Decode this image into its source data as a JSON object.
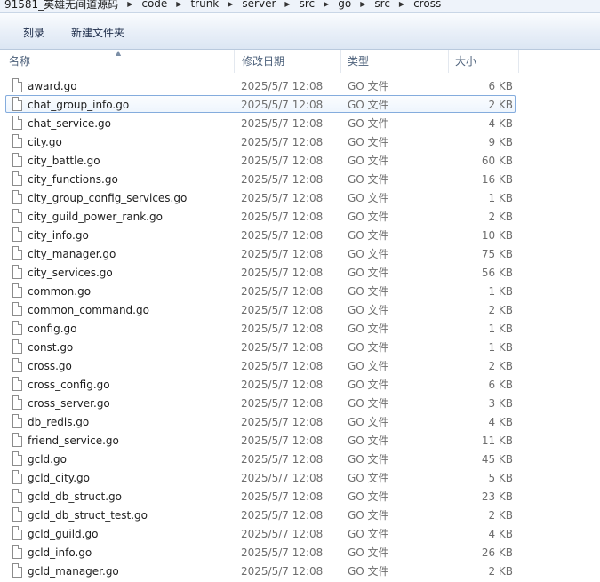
{
  "address": {
    "crumbs": [
      "91581_英雄无间道源码",
      "code",
      "trunk",
      "server",
      "src",
      "go",
      "src",
      "cross"
    ]
  },
  "toolbar": {
    "burn_label": "刻录",
    "new_folder_label": "新建文件夹"
  },
  "columns": {
    "name": "名称",
    "date": "修改日期",
    "type": "类型",
    "size": "大小"
  },
  "selected_index": 1,
  "files": [
    {
      "name": "award.go",
      "date": "2025/5/7 12:08",
      "type": "GO 文件",
      "size": "6 KB"
    },
    {
      "name": "chat_group_info.go",
      "date": "2025/5/7 12:08",
      "type": "GO 文件",
      "size": "2 KB"
    },
    {
      "name": "chat_service.go",
      "date": "2025/5/7 12:08",
      "type": "GO 文件",
      "size": "4 KB"
    },
    {
      "name": "city.go",
      "date": "2025/5/7 12:08",
      "type": "GO 文件",
      "size": "9 KB"
    },
    {
      "name": "city_battle.go",
      "date": "2025/5/7 12:08",
      "type": "GO 文件",
      "size": "60 KB"
    },
    {
      "name": "city_functions.go",
      "date": "2025/5/7 12:08",
      "type": "GO 文件",
      "size": "16 KB"
    },
    {
      "name": "city_group_config_services.go",
      "date": "2025/5/7 12:08",
      "type": "GO 文件",
      "size": "1 KB"
    },
    {
      "name": "city_guild_power_rank.go",
      "date": "2025/5/7 12:08",
      "type": "GO 文件",
      "size": "2 KB"
    },
    {
      "name": "city_info.go",
      "date": "2025/5/7 12:08",
      "type": "GO 文件",
      "size": "10 KB"
    },
    {
      "name": "city_manager.go",
      "date": "2025/5/7 12:08",
      "type": "GO 文件",
      "size": "75 KB"
    },
    {
      "name": "city_services.go",
      "date": "2025/5/7 12:08",
      "type": "GO 文件",
      "size": "56 KB"
    },
    {
      "name": "common.go",
      "date": "2025/5/7 12:08",
      "type": "GO 文件",
      "size": "1 KB"
    },
    {
      "name": "common_command.go",
      "date": "2025/5/7 12:08",
      "type": "GO 文件",
      "size": "2 KB"
    },
    {
      "name": "config.go",
      "date": "2025/5/7 12:08",
      "type": "GO 文件",
      "size": "1 KB"
    },
    {
      "name": "const.go",
      "date": "2025/5/7 12:08",
      "type": "GO 文件",
      "size": "1 KB"
    },
    {
      "name": "cross.go",
      "date": "2025/5/7 12:08",
      "type": "GO 文件",
      "size": "2 KB"
    },
    {
      "name": "cross_config.go",
      "date": "2025/5/7 12:08",
      "type": "GO 文件",
      "size": "6 KB"
    },
    {
      "name": "cross_server.go",
      "date": "2025/5/7 12:08",
      "type": "GO 文件",
      "size": "3 KB"
    },
    {
      "name": "db_redis.go",
      "date": "2025/5/7 12:08",
      "type": "GO 文件",
      "size": "4 KB"
    },
    {
      "name": "friend_service.go",
      "date": "2025/5/7 12:08",
      "type": "GO 文件",
      "size": "11 KB"
    },
    {
      "name": "gcld.go",
      "date": "2025/5/7 12:08",
      "type": "GO 文件",
      "size": "45 KB"
    },
    {
      "name": "gcld_city.go",
      "date": "2025/5/7 12:08",
      "type": "GO 文件",
      "size": "5 KB"
    },
    {
      "name": "gcld_db_struct.go",
      "date": "2025/5/7 12:08",
      "type": "GO 文件",
      "size": "23 KB"
    },
    {
      "name": "gcld_db_struct_test.go",
      "date": "2025/5/7 12:08",
      "type": "GO 文件",
      "size": "2 KB"
    },
    {
      "name": "gcld_guild.go",
      "date": "2025/5/7 12:08",
      "type": "GO 文件",
      "size": "4 KB"
    },
    {
      "name": "gcld_info.go",
      "date": "2025/5/7 12:08",
      "type": "GO 文件",
      "size": "26 KB"
    },
    {
      "name": "gcld_manager.go",
      "date": "2025/5/7 12:08",
      "type": "GO 文件",
      "size": "2 KB"
    }
  ]
}
